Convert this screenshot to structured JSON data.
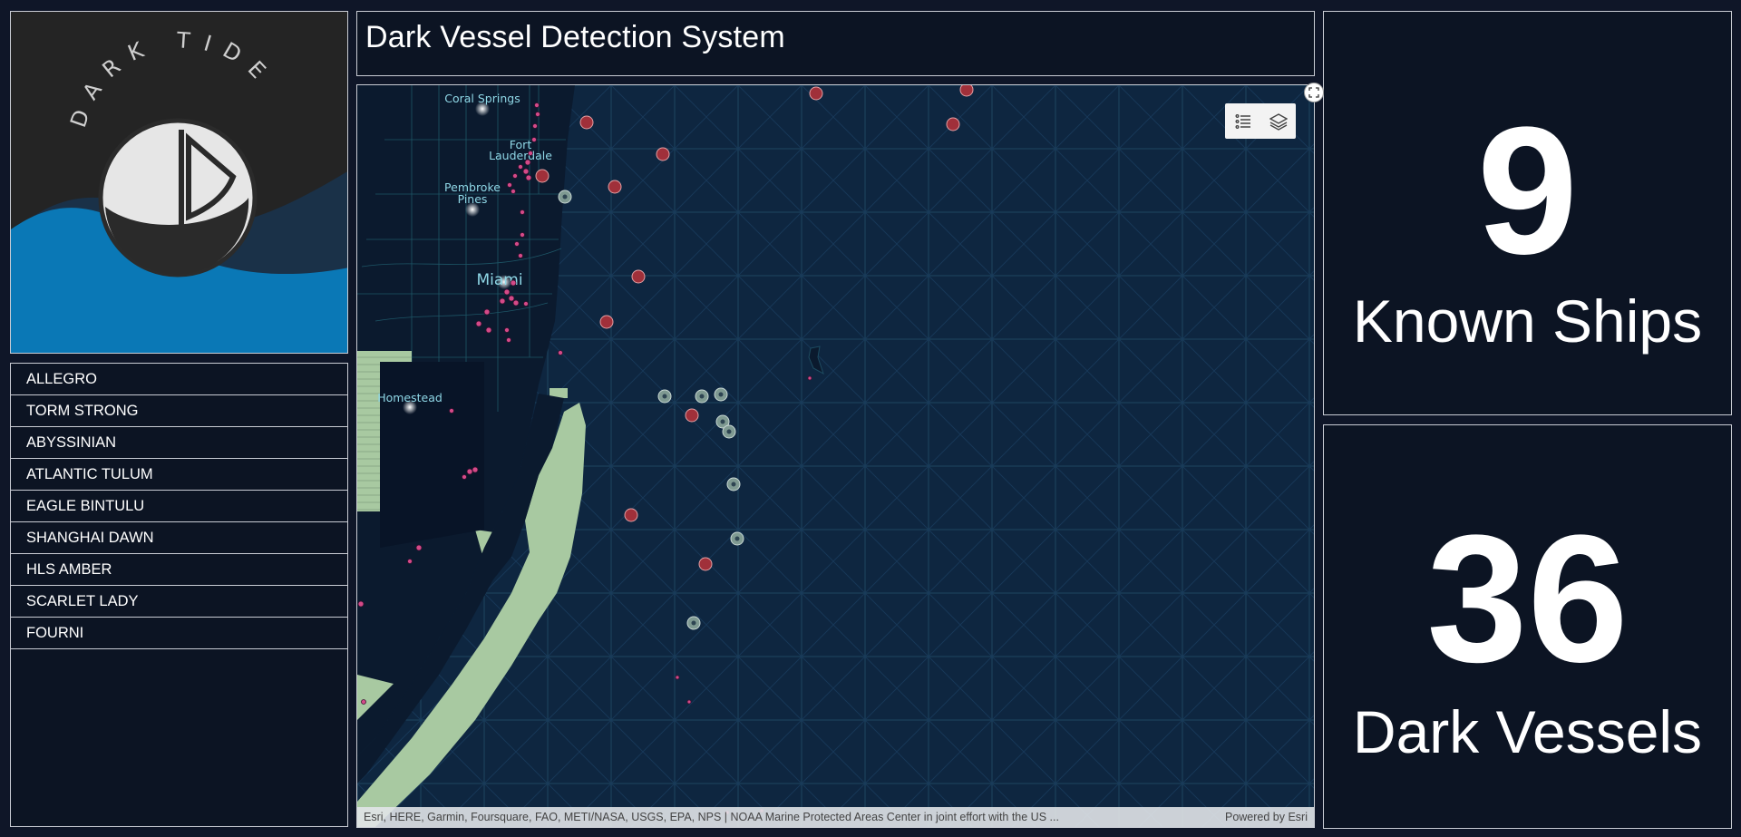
{
  "app": {
    "title": "Dark Vessel Detection System"
  },
  "logo": {
    "text": "DARK TIDE",
    "icon": "dark-tide-logo"
  },
  "ship_list": [
    "ALLEGRO",
    "TORM STRONG",
    "ABYSSINIAN",
    "ATLANTIC TULUM",
    "EAGLE BINTULU",
    "SHANGHAI DAWN",
    "HLS AMBER",
    "SCARLET LADY",
    "FOURNI"
  ],
  "map": {
    "cities": [
      "Coral Springs",
      "Fort\nLauderdale",
      "Pembroke\nPines",
      "Miami",
      "Homestead"
    ],
    "toolbar": [
      {
        "icon": "legend-list-icon"
      },
      {
        "icon": "layers-icon"
      }
    ],
    "attribution": "Esri, HERE, Garmin, Foursquare, FAO, METI/NASA, USGS, EPA, NPS | NOAA Marine Protected Areas Center in joint effort with the US ...",
    "powered_by": "Powered by Esri",
    "colors": {
      "ocean": "#0e2640",
      "land": "#0b1a2e",
      "protected_area": "#a8c9a1",
      "dark_vessel": "#a0303a",
      "known_ship": "#7f9a92",
      "ais_point": "#d44a88"
    }
  },
  "stats": {
    "known_ships": {
      "value": "9",
      "label": "Known Ships"
    },
    "dark_vessels": {
      "value": "36",
      "label": "Dark Vessels"
    }
  }
}
